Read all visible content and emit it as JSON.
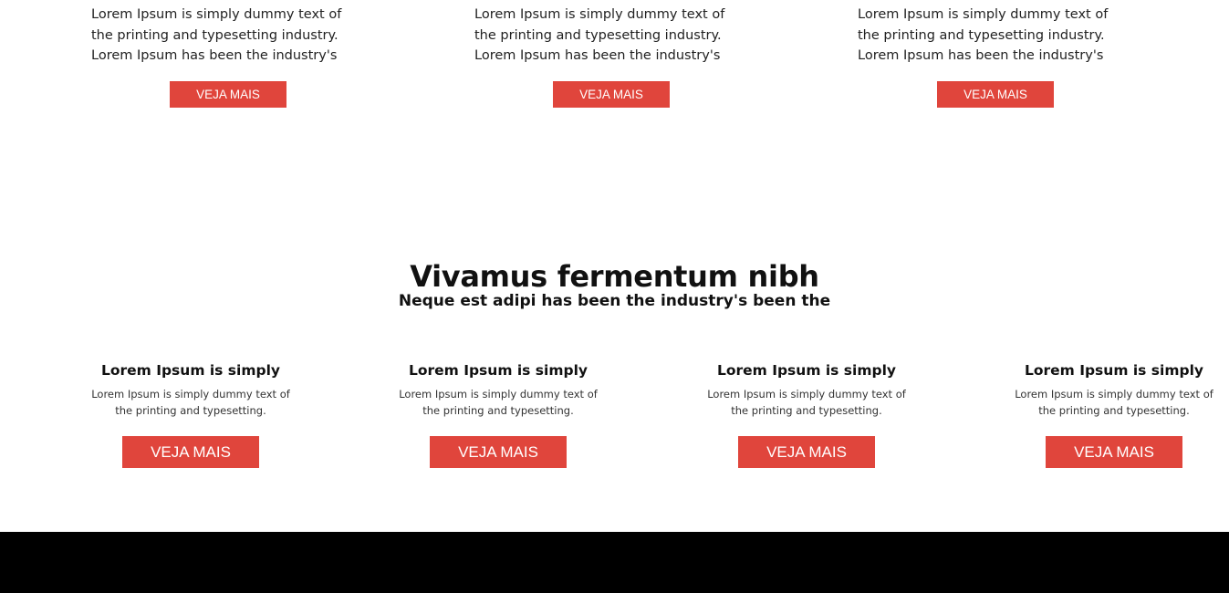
{
  "top_cards": [
    {
      "text": "Lorem Ipsum is simply dummy text of the printing and typesetting industry. Lorem Ipsum has been the industry's standard dummy text",
      "button_label": "VEJA MAIS"
    },
    {
      "text": "Lorem Ipsum is simply dummy text of the printing and typesetting industry. Lorem Ipsum has been the industry's standard dummy text",
      "button_label": "VEJA MAIS"
    },
    {
      "text": "Lorem Ipsum is simply dummy text of the printing and typesetting industry. Lorem Ipsum has been the industry's standard dummy text",
      "button_label": "VEJA MAIS"
    }
  ],
  "section": {
    "title": "Vivamus fermentum nibh",
    "subtitle": "Neque est adipi has been the industry's been the"
  },
  "bottom_cards": [
    {
      "title": "Lorem Ipsum is simply",
      "text": "Lorem Ipsum is simply dummy text of the printing and typesetting.",
      "button_label": "VEJA MAIS"
    },
    {
      "title": "Lorem Ipsum is simply",
      "text": "Lorem Ipsum is simply dummy text of the printing and typesetting.",
      "button_label": "VEJA MAIS"
    },
    {
      "title": "Lorem Ipsum is simply",
      "text": "Lorem Ipsum is simply dummy text of the printing and typesetting.",
      "button_label": "VEJA MAIS"
    },
    {
      "title": "Lorem Ipsum is simply",
      "text": "Lorem Ipsum is simply dummy text of the printing and typesetting.",
      "button_label": "VEJA MAIS"
    }
  ],
  "colors": {
    "accent": "#e0453c",
    "footer": "#000000",
    "background": "#ffffff"
  }
}
